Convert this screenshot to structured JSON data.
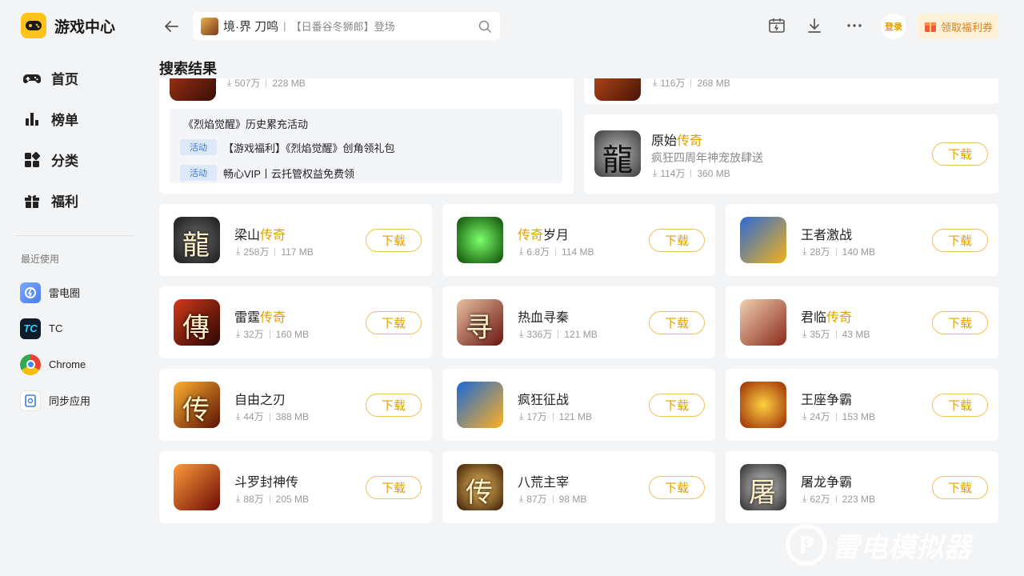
{
  "app": {
    "title": "游戏中心"
  },
  "nav": [
    {
      "label": "首页",
      "icon": "gamepad-icon"
    },
    {
      "label": "榜单",
      "icon": "ranking-icon"
    },
    {
      "label": "分类",
      "icon": "category-icon"
    },
    {
      "label": "福利",
      "icon": "gift-icon"
    }
  ],
  "recent": {
    "title": "最近使用",
    "items": [
      {
        "label": "雷电圈",
        "icon": "leidian-circle-icon",
        "color": "#5b8def"
      },
      {
        "label": "TC",
        "icon": "tc-icon",
        "color": "#0d1b2a"
      },
      {
        "label": "Chrome",
        "icon": "chrome-icon",
        "color": "#4285f4"
      },
      {
        "label": "同步应用",
        "icon": "sync-app-icon",
        "color": "#3b7be0"
      }
    ]
  },
  "search": {
    "game": "境·界 刀鸣",
    "placeholder": "【日番谷冬狮郎】登场"
  },
  "header": {
    "login": "登录",
    "coupon": "领取福利券"
  },
  "section_title": "搜索结果",
  "top_partial": {
    "left_meta": {
      "downloads": "507万",
      "size": "228 MB"
    },
    "right_meta": {
      "downloads": "116万",
      "size": "268 MB"
    }
  },
  "activities": [
    {
      "tag": "",
      "text": "《烈焰觉醒》历史累充活动"
    },
    {
      "tag": "活动",
      "text": "【游戏福利】《烈焰觉醒》创角领礼包"
    },
    {
      "tag": "活动",
      "text": "畅心VIP丨云托管权益免费领"
    }
  ],
  "featured": {
    "name_plain": "原始",
    "name_hl": "传奇",
    "desc": "疯狂四周年神宠放肆送",
    "downloads": "114万",
    "size": "360 MB",
    "button": "下载"
  },
  "apps": [
    {
      "pre": "梁山",
      "hl": "传奇",
      "post": "",
      "downloads": "258万",
      "size": "117 MB",
      "button": "下载"
    },
    {
      "pre": "",
      "hl": "传奇",
      "post": "岁月",
      "downloads": "6.8万",
      "size": "114 MB",
      "button": "下载"
    },
    {
      "pre": "王者激战",
      "hl": "",
      "post": "",
      "downloads": "28万",
      "size": "140 MB",
      "button": "下载"
    },
    {
      "pre": "雷霆",
      "hl": "传奇",
      "post": "",
      "downloads": "32万",
      "size": "160 MB",
      "button": "下载"
    },
    {
      "pre": "热血寻秦",
      "hl": "",
      "post": "",
      "downloads": "336万",
      "size": "121 MB",
      "button": "下载"
    },
    {
      "pre": "君临",
      "hl": "传奇",
      "post": "",
      "downloads": "35万",
      "size": "43 MB",
      "button": "下载"
    },
    {
      "pre": "自由之刃",
      "hl": "",
      "post": "",
      "downloads": "44万",
      "size": "388 MB",
      "button": "下载"
    },
    {
      "pre": "疯狂征战",
      "hl": "",
      "post": "",
      "downloads": "17万",
      "size": "121 MB",
      "button": "下载"
    },
    {
      "pre": "王座争霸",
      "hl": "",
      "post": "",
      "downloads": "24万",
      "size": "153 MB",
      "button": "下载"
    },
    {
      "pre": "斗罗封神传",
      "hl": "",
      "post": "",
      "downloads": "88万",
      "size": "205 MB",
      "button": "下载"
    },
    {
      "pre": "八荒主宰",
      "hl": "",
      "post": "",
      "downloads": "87万",
      "size": "98 MB",
      "button": "下载"
    },
    {
      "pre": "屠龙争霸",
      "hl": "",
      "post": "",
      "downloads": "62万",
      "size": "223 MB",
      "button": "下载"
    }
  ],
  "watermark": "雷电模拟器",
  "colors": {
    "accent": "#e0a000",
    "logo": "#ffc21a",
    "tag": "#3b7be0"
  }
}
